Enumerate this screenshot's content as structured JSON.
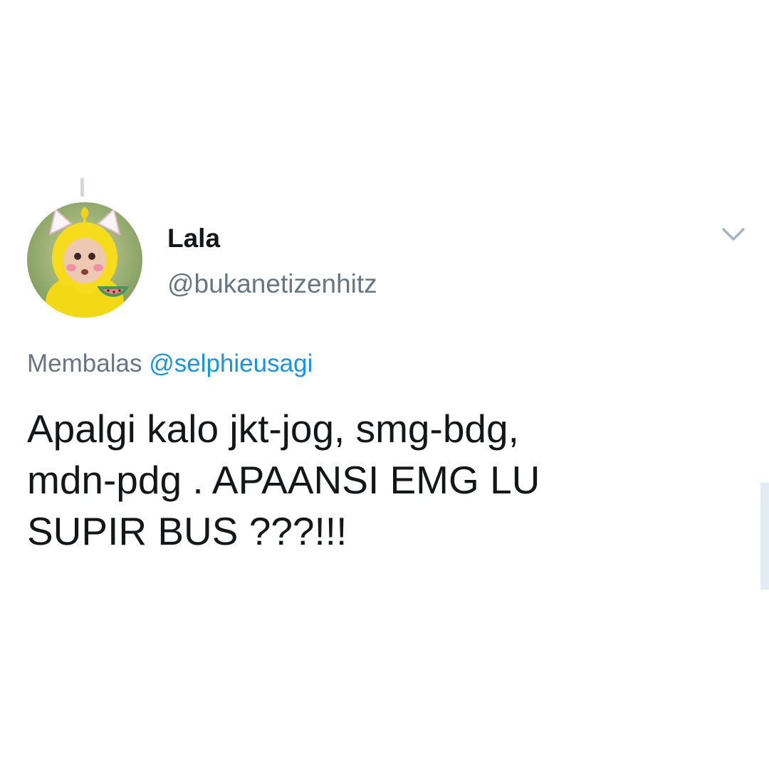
{
  "tweet": {
    "author": {
      "display_name": "Lala",
      "handle": "@bukanetizenhitz",
      "avatar_icon": "teletubby-laa-laa-avatar"
    },
    "reply": {
      "prefix": "Membalas",
      "mention": "@selphieusagi"
    },
    "text_lines": [
      "Apalgi kalo jkt-jog, smg-bdg,",
      "mdn-pdg . APAANSI EMG LU",
      "SUPIR BUS ???!!!"
    ],
    "menu_icon": "chevron-down-icon"
  },
  "colors": {
    "text_primary": "#14171a",
    "text_secondary": "#657786",
    "link": "#1b95e0",
    "thread_line": "#cfd9de"
  }
}
